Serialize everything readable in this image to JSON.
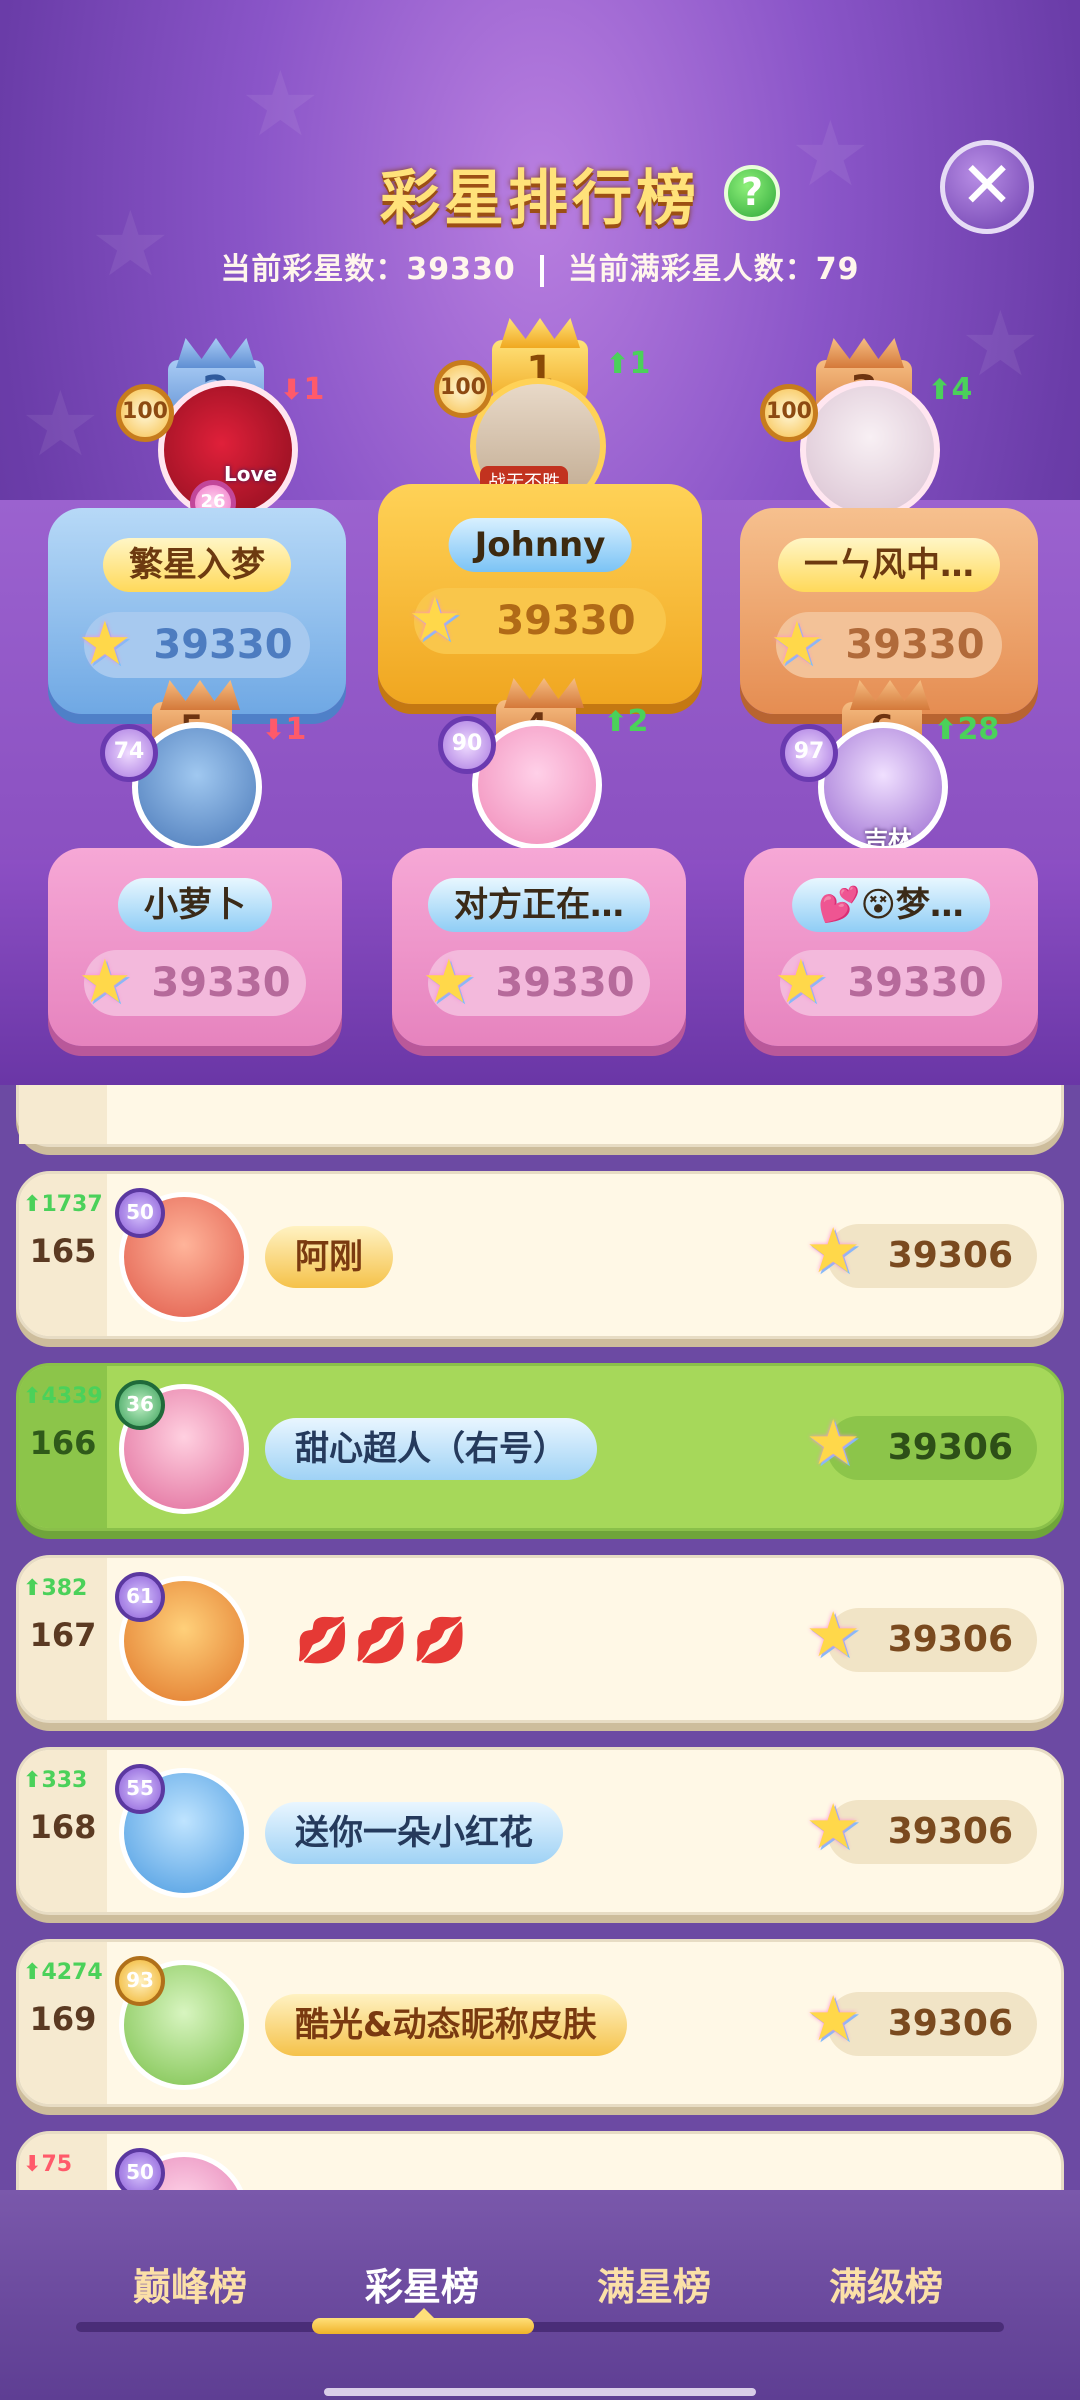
{
  "header": {
    "title": "彩星排行榜",
    "help_icon": "?",
    "close_icon": "✕",
    "stat_current_label": "当前彩星数：39330",
    "stat_full_label": "当前满彩星人数：79"
  },
  "podium": [
    {
      "rank": "1",
      "name": "Johnny",
      "score": "39330",
      "level": "100",
      "change": "1",
      "direction": "up",
      "tag": "战无不胜"
    },
    {
      "rank": "2",
      "name": "繁星入梦",
      "score": "39330",
      "level": "100",
      "change": "1",
      "direction": "down",
      "tag": "Love",
      "badge": "26"
    },
    {
      "rank": "3",
      "name": "一ㄣ风中…",
      "score": "39330",
      "level": "100",
      "change": "4",
      "direction": "up"
    },
    {
      "rank": "4",
      "name": "对方正在…",
      "score": "39330",
      "level": "90",
      "change": "2",
      "direction": "up"
    },
    {
      "rank": "5",
      "name": "小萝卜",
      "score": "39330",
      "level": "74",
      "change": "1",
      "direction": "down"
    },
    {
      "rank": "6",
      "name": "💕😵梦…",
      "score": "39330",
      "level": "97",
      "change": "28",
      "direction": "up",
      "tag": "吉林"
    }
  ],
  "list": [
    {
      "rank": "165",
      "change": "1737",
      "direction": "up",
      "level": "50",
      "name": "阿刚",
      "score": "39306",
      "highlight": false,
      "style": "gold"
    },
    {
      "rank": "166",
      "change": "4339",
      "direction": "up",
      "level": "36",
      "name": "甜心超人（右号）",
      "score": "39306",
      "highlight": true,
      "style": "blue"
    },
    {
      "rank": "167",
      "change": "382",
      "direction": "up",
      "level": "61",
      "name": "💋💋💋",
      "score": "39306",
      "highlight": false,
      "style": "plain"
    },
    {
      "rank": "168",
      "change": "333",
      "direction": "up",
      "level": "55",
      "name": "送你一朵小红花",
      "score": "39306",
      "highlight": false,
      "style": "blue"
    },
    {
      "rank": "169",
      "change": "4274",
      "direction": "up",
      "level": "93",
      "name": "酷光&动态昵称皮肤",
      "score": "39306",
      "highlight": false,
      "style": "gold"
    },
    {
      "rank": "",
      "change": "75",
      "direction": "down",
      "level": "50",
      "name": "",
      "score": "",
      "highlight": false,
      "style": "blue"
    }
  ],
  "tabs": [
    {
      "label": "巅峰榜",
      "active": false
    },
    {
      "label": "彩星榜",
      "active": true
    },
    {
      "label": "满星榜",
      "active": false
    },
    {
      "label": "满级榜",
      "active": false
    }
  ],
  "colors": {
    "up": "#4bd15a",
    "down": "#ff5a6a",
    "row_highlight": "#a6d85a",
    "bg_purple": "#6c4aa3"
  },
  "icons": {
    "star": "rainbow-star-icon",
    "arrow_up": "arrow-up-icon",
    "arrow_down": "arrow-down-icon",
    "crown": "crown-icon"
  }
}
